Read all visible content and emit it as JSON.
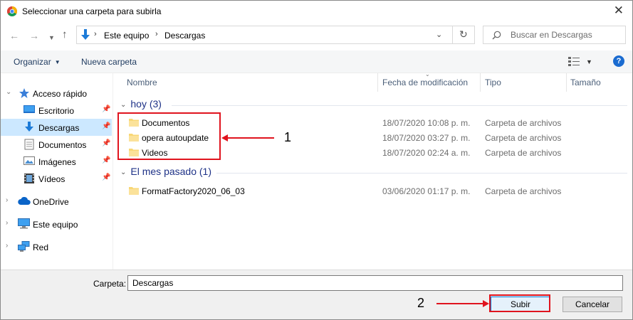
{
  "window": {
    "title": "Seleccionar una carpeta para subirla",
    "close_glyph": "✕"
  },
  "nav": {
    "back_glyph": "←",
    "forward_glyph": "→",
    "up_glyph": "↑",
    "breadcrumb": [
      "Este equipo",
      "Descargas"
    ],
    "search_placeholder": "Buscar en Descargas"
  },
  "toolbar": {
    "organize_label": "Organizar",
    "new_folder_label": "Nueva carpeta",
    "help_glyph": "?"
  },
  "sidebar": {
    "items": [
      {
        "label": "Acceso rápido",
        "icon": "star-icon"
      },
      {
        "label": "Escritorio",
        "icon": "desktop-icon"
      },
      {
        "label": "Descargas",
        "icon": "download-icon"
      },
      {
        "label": "Documentos",
        "icon": "documents-icon"
      },
      {
        "label": "Imágenes",
        "icon": "pictures-icon"
      },
      {
        "label": "Vídeos",
        "icon": "videos-icon"
      },
      {
        "label": "OneDrive",
        "icon": "cloud-icon"
      },
      {
        "label": "Este equipo",
        "icon": "computer-icon"
      },
      {
        "label": "Red",
        "icon": "network-icon"
      }
    ]
  },
  "columns": [
    "Nombre",
    "Fecha de modificación",
    "Tipo",
    "Tamaño"
  ],
  "groups": [
    {
      "label": "hoy (3)",
      "files": [
        {
          "name": "Documentos",
          "date": "18/07/2020 10:08 p. m.",
          "type": "Carpeta de archivos"
        },
        {
          "name": "opera autoupdate",
          "date": "18/07/2020 03:27 p. m.",
          "type": "Carpeta de archivos"
        },
        {
          "name": "Videos",
          "date": "18/07/2020 02:24 a. m.",
          "type": "Carpeta de archivos"
        }
      ]
    },
    {
      "label": "El mes pasado (1)",
      "files": [
        {
          "name": "FormatFactory2020_06_03",
          "date": "03/06/2020 01:17 p. m.",
          "type": "Carpeta de archivos"
        }
      ]
    }
  ],
  "footer": {
    "folder_label": "Carpeta:",
    "folder_value": "Descargas",
    "upload_label": "Subir",
    "cancel_label": "Cancelar"
  },
  "annotations": {
    "one": "1",
    "two": "2",
    "color": "#e0141e"
  },
  "colors": {
    "selection": "#cce8ff",
    "group_header": "#1e3287",
    "accent": "#0078d7"
  }
}
